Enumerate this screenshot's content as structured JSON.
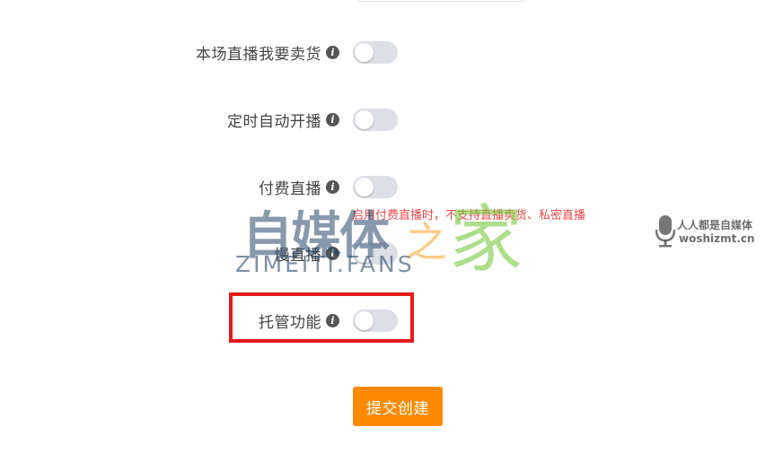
{
  "form": {
    "rows": [
      {
        "label": "本场直播我要卖货",
        "enabled": false
      },
      {
        "label": "定时自动开播",
        "enabled": false
      },
      {
        "label": "付费直播",
        "enabled": false,
        "hint": "启用付费直播时，不支持直播卖货、私密直播"
      },
      {
        "label": "慢直播",
        "enabled": false
      },
      {
        "label": "托管功能",
        "enabled": false
      }
    ],
    "info_glyph": "i",
    "submit_label": "提交创建"
  },
  "watermark": {
    "main_zh_1": "自媒体",
    "main_zh_2": "之",
    "main_zh_3": "家",
    "main_en": "ZIMEITI.FANS",
    "right_zh": "人人都是自媒体",
    "right_en": "woshizmt.cn"
  },
  "colors": {
    "accent": "#ff8a00",
    "hint": "#e8494b",
    "highlight": "#e61b1b",
    "switch_off": "#dcdfe6"
  }
}
